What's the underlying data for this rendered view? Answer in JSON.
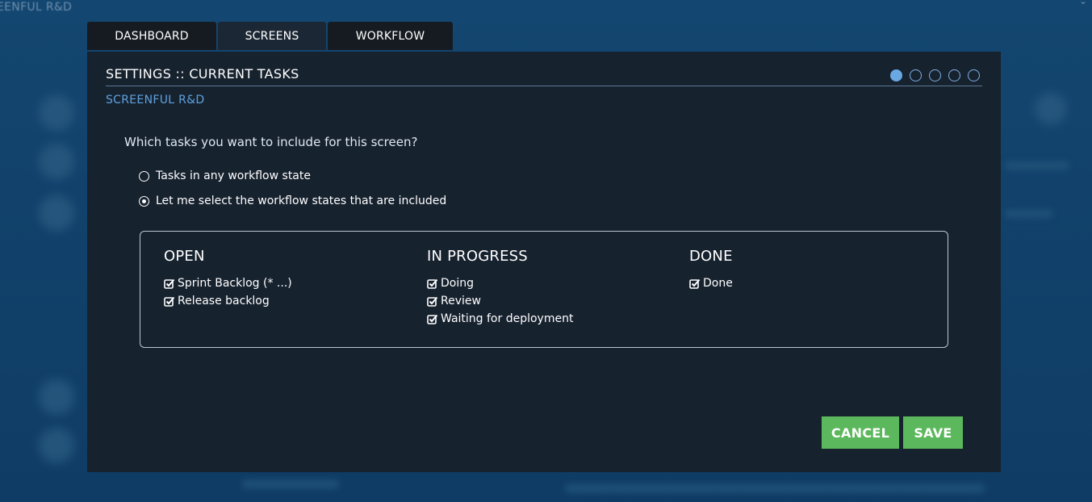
{
  "background": {
    "app_title": "EENFUL R&D"
  },
  "tabs": [
    {
      "label": "DASHBOARD"
    },
    {
      "label": "SCREENS"
    },
    {
      "label": "WORKFLOW"
    }
  ],
  "modal": {
    "title": "SETTINGS :: CURRENT TASKS",
    "subtitle": "SCREENFUL R&D",
    "step_indicator": {
      "total": 5,
      "active": 1
    },
    "question": "Which tasks you want to include for this screen?",
    "options": [
      {
        "label": "Tasks in any workflow state",
        "selected": false
      },
      {
        "label": "Let me select the workflow states that are included",
        "selected": true
      }
    ],
    "columns": [
      {
        "heading": "OPEN",
        "items": [
          {
            "label": "Sprint Backlog (* ...)",
            "checked": true
          },
          {
            "label": "Release backlog",
            "checked": true
          }
        ]
      },
      {
        "heading": "IN PROGRESS",
        "items": [
          {
            "label": "Doing",
            "checked": true
          },
          {
            "label": "Review",
            "checked": true
          },
          {
            "label": "Waiting for deployment",
            "checked": true
          }
        ]
      },
      {
        "heading": "DONE",
        "items": [
          {
            "label": "Done",
            "checked": true
          }
        ]
      }
    ],
    "buttons": {
      "cancel": "CANCEL",
      "save": "SAVE"
    }
  },
  "colors": {
    "accent_blue": "#5da2df",
    "button_green": "#5cb85c",
    "modal_bg": "#17222f",
    "page_bg": "#114069"
  }
}
